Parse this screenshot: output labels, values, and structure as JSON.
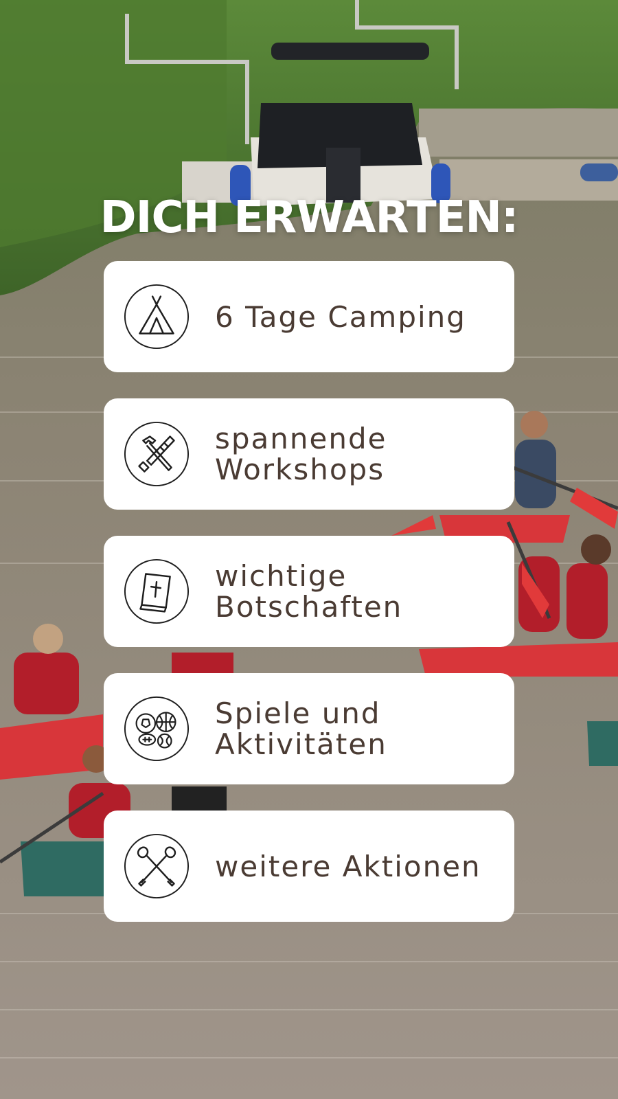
{
  "heading": "DICH ERWARTEN:",
  "colors": {
    "text": "#4a3b33",
    "card": "#ffffff",
    "heading": "#ffffff"
  },
  "items": [
    {
      "lines": [
        "6 Tage Camping"
      ],
      "icon": "tent-icon"
    },
    {
      "lines": [
        "spannende",
        "Workshops"
      ],
      "icon": "tools-icon"
    },
    {
      "lines": [
        "wichtige",
        "Botschaften"
      ],
      "icon": "bible-icon"
    },
    {
      "lines": [
        "Spiele und",
        "Aktivitäten"
      ],
      "icon": "sports-balls-icon"
    },
    {
      "lines": [
        "weitere Aktionen"
      ],
      "icon": "crossed-paddles-icon"
    }
  ]
}
